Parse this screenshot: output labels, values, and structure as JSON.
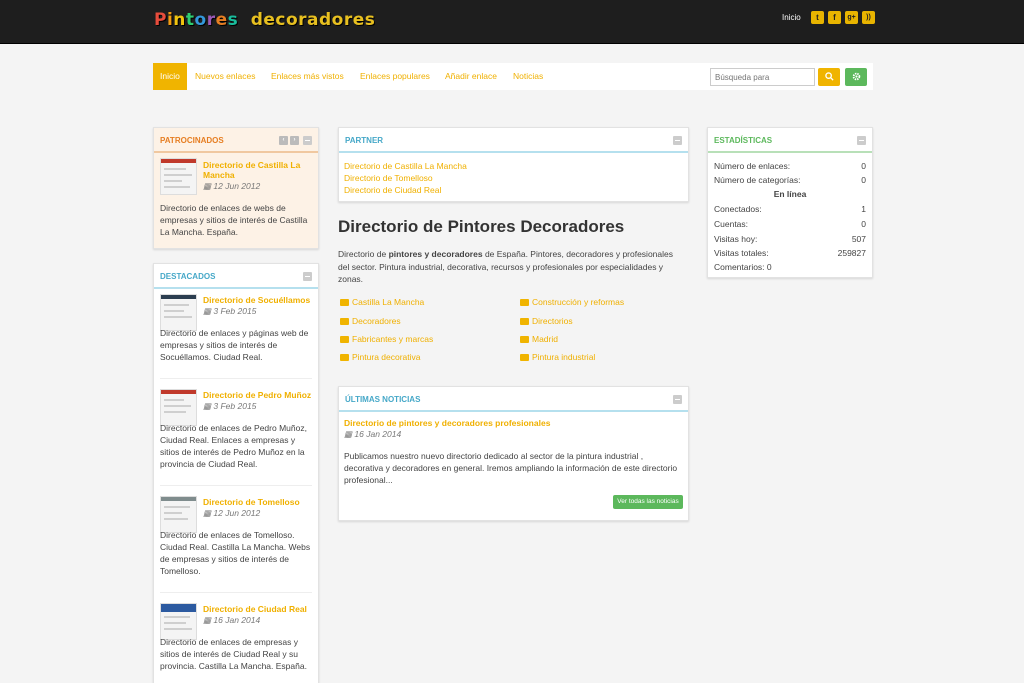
{
  "header": {
    "logo_word1": [
      "P",
      "i",
      "n",
      "t",
      "o",
      "r",
      "e",
      "s"
    ],
    "logo_word2": "decoradores",
    "inicio": "Inicio",
    "social": [
      {
        "icon": "twitter-icon",
        "glyph": "t"
      },
      {
        "icon": "facebook-icon",
        "glyph": "f"
      },
      {
        "icon": "google-plus-icon",
        "glyph": "g+"
      },
      {
        "icon": "rss-icon",
        "glyph": "))"
      }
    ]
  },
  "nav": {
    "items": [
      "Inicio",
      "Nuevos enlaces",
      "Enlaces más vistos",
      "Enlaces populares",
      "Añadir enlace",
      "Noticias"
    ],
    "search_placeholder": "Búsqueda para"
  },
  "patrocinados": {
    "title": "PATROCINADOS",
    "entry": {
      "title": "Directorio de Castilla La Mancha",
      "date": "12 Jun 2012",
      "desc": "Directorio de enlaces de webs de empresas y sitios de interés de Castilla La Mancha. España."
    }
  },
  "destacados": {
    "title": "DESTACADOS",
    "entries": [
      {
        "title": "Directorio de Socuéllamos",
        "date": "3 Feb 2015",
        "desc": "Directorio de enlaces y páginas web de empresas y sitios de interés de Socuéllamos. Ciudad Real."
      },
      {
        "title": "Directorio de Pedro Muñoz",
        "date": "3 Feb 2015",
        "desc": "Directorio de enlaces de Pedro Muñoz, Ciudad Real. Enlaces a empresas y sitios de interés de Pedro Muñoz en la provincia de Ciudad Real."
      },
      {
        "title": "Directorio de Tomelloso",
        "date": "12 Jun 2012",
        "desc": "Directorio de enlaces de Tomelloso. Ciudad Real. Castilla La Mancha. Webs de empresas y sitios de interés de Tomelloso."
      },
      {
        "title": "Directorio de Ciudad Real",
        "date": "16 Jan 2014",
        "desc": "Directorio de enlaces de empresas y sitios de interés de Ciudad Real y su provincia. Castilla La Mancha. España."
      }
    ]
  },
  "partner": {
    "title": "PARTNER",
    "links": [
      "Directorio de Castilla La Mancha",
      "Directorio de Tomelloso",
      "Directorio de Ciudad Real"
    ]
  },
  "main": {
    "title": "Directorio de Pintores Decoradores",
    "intro_a": "Directorio de ",
    "intro_b": "pintores y decoradores",
    "intro_c": " de España. Pintores, decoradores y profesionales del sector. Pintura industrial, decorativa, recursos y profesionales por especialidades y zonas.",
    "categories": [
      "Castilla La Mancha",
      "Construcción y reformas",
      "Decoradores",
      "Directorios",
      "Fabricantes y marcas",
      "Madrid",
      "Pintura decorativa",
      "Pintura industrial"
    ]
  },
  "noticias": {
    "title": "ÚLTIMAS NOTICIAS",
    "entry_title": "Directorio de pintores y decoradores profesionales",
    "entry_date": "16 Jan 2014",
    "entry_desc": "Publicamos nuestro nuevo directorio dedicado al sector de la pintura industrial , decorativa y decoradores en general. Iremos ampliando la información de este directorio profesional...",
    "button": "Ver todas las noticias"
  },
  "estadisticas": {
    "title": "ESTADÍSTICAS",
    "rows": [
      {
        "label": "Número de enlaces:",
        "value": "0"
      },
      {
        "label": "Número de categorías:",
        "value": "0"
      }
    ],
    "online_label": "En línea",
    "online_rows": [
      {
        "label": "Conectados:",
        "value": "1"
      },
      {
        "label": "Cuentas:",
        "value": "0"
      },
      {
        "label": "Visitas hoy:",
        "value": "507"
      },
      {
        "label": "Visitas totales:",
        "value": "259827"
      }
    ],
    "comments": "Comentarios: 0"
  },
  "colors": {
    "accent": "#f0b400",
    "header": "#1e1e1e",
    "green": "#5cb85c",
    "blue": "#46a8c8",
    "orange": "#e67e22"
  }
}
